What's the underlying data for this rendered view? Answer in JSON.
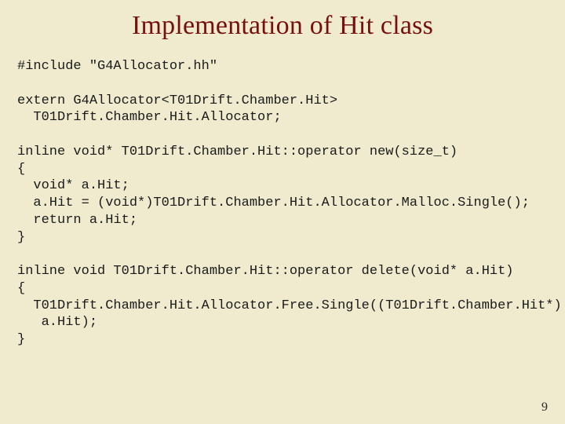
{
  "title": "Implementation of Hit class",
  "code": "#include \"G4Allocator.hh\"\n\nextern G4Allocator<T01Drift.Chamber.Hit>\n  T01Drift.Chamber.Hit.Allocator;\n\ninline void* T01Drift.Chamber.Hit::operator new(size_t)\n{\n  void* a.Hit;\n  a.Hit = (void*)T01Drift.Chamber.Hit.Allocator.Malloc.Single();\n  return a.Hit;\n}\n\ninline void T01Drift.Chamber.Hit::operator delete(void* a.Hit)\n{\n  T01Drift.Chamber.Hit.Allocator.Free.Single((T01Drift.Chamber.Hit*)\n   a.Hit);\n}",
  "page_number": "9"
}
